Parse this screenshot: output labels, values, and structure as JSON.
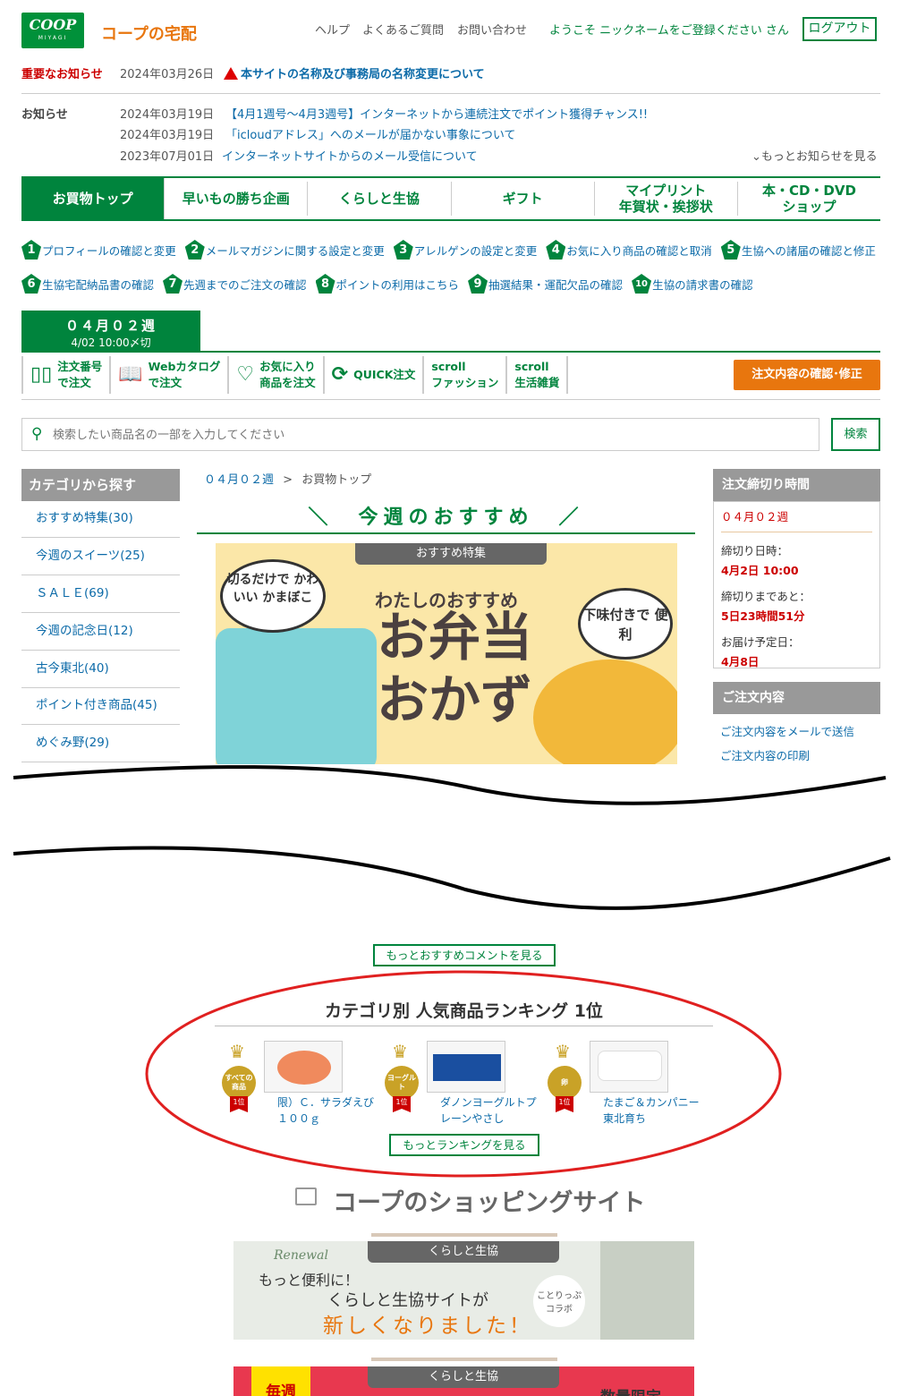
{
  "header": {
    "logo_text": "COOP",
    "logo_sub": "MIYAGI",
    "site_title": "コープの宅配",
    "links": [
      "ヘルプ",
      "よくあるご質問",
      "お問い合わせ"
    ],
    "welcome": "ようこそ ニックネームをご登録ください さん",
    "logout": "ログアウト"
  },
  "important_notice": {
    "label": "重要なお知らせ",
    "date": "2024年03月26日",
    "text": "本サイトの名称及び事務局の名称変更について"
  },
  "news": {
    "label": "お知らせ",
    "items": [
      {
        "date": "2024年03月19日",
        "text": "【4月1週号～4月3週号】インターネットから連続注文でポイント獲得チャンス!!"
      },
      {
        "date": "2024年03月19日",
        "text": "「icloudアドレス」へのメールが届かない事象について"
      },
      {
        "date": "2023年07月01日",
        "text": "インターネットサイトからのメール受信について"
      }
    ],
    "more": "もっとお知らせを見る"
  },
  "main_nav": [
    {
      "label": "お買物トップ",
      "label2": ""
    },
    {
      "label": "早いもの勝ち企画",
      "label2": ""
    },
    {
      "label": "くらしと生協",
      "label2": ""
    },
    {
      "label": "ギフト",
      "label2": ""
    },
    {
      "label": "マイプリント",
      "label2": "年賀状・挨拶状"
    },
    {
      "label": "本・CD・DVD",
      "label2": "ショップ"
    }
  ],
  "steps": [
    {
      "num": "1",
      "label": "プロフィールの確認と変更"
    },
    {
      "num": "2",
      "label": "メールマガジンに関する設定と変更"
    },
    {
      "num": "3",
      "label": "アレルゲンの設定と変更"
    },
    {
      "num": "4",
      "label": "お気に入り商品の確認と取消"
    },
    {
      "num": "5",
      "label": "生協への諸届の確認と修正"
    },
    {
      "num": "6",
      "label": "生協宅配納品書の確認"
    },
    {
      "num": "7",
      "label": "先週までのご注文の確認"
    },
    {
      "num": "8",
      "label": "ポイントの利用はこちら"
    },
    {
      "num": "9",
      "label": "抽選結果・運配欠品の確認"
    },
    {
      "num": "10",
      "label": "生協の請求書の確認"
    }
  ],
  "week_tab": {
    "week": "０４月０２週",
    "deadline": "4/02 10:00〆切"
  },
  "order_nav": [
    {
      "icon": "book-icon",
      "l1": "注文番号",
      "l2": "で注文"
    },
    {
      "icon": "catalog-icon",
      "l1": "Webカタログ",
      "l2": "で注文"
    },
    {
      "icon": "heart-icon",
      "l1": "お気に入り",
      "l2": "商品を注文"
    },
    {
      "icon": "refresh-icon",
      "l1": "QUICK注文",
      "l2": ""
    },
    {
      "icon": "",
      "l1": "scroll",
      "l2": "ファッション"
    },
    {
      "icon": "",
      "l1": "scroll",
      "l2": "生活雑貨"
    }
  ],
  "confirm_button": "注文内容の確認･修正",
  "search": {
    "placeholder": "検索したい商品名の一部を入力してください",
    "button": "検索"
  },
  "category": {
    "title": "カテゴリから探す",
    "items": [
      "おすすめ特集(30)",
      "今週のスイーツ(25)",
      "ＳＡＬＥ(69)",
      "今週の記念日(12)",
      "古今東北(40)",
      "ポイント付き商品(45)",
      "めぐみ野(29)"
    ]
  },
  "breadcrumb": {
    "week": "０４月０２週",
    "sep": ">",
    "current": "お買物トップ"
  },
  "recommend": {
    "title": "今週のおすすめ",
    "banner_tag": "おすすめ特集",
    "banner_sub": "わたしのおすすめ",
    "banner_big1": "お弁当",
    "banner_big2": "おかず",
    "bubble1": "切るだけで かわいい かまぼこ",
    "bubble2": "下味付きで 便利"
  },
  "deadline": {
    "title": "注文締切り時間",
    "week": "０４月０２週",
    "close_label": "締切り日時：",
    "close_value": "4月2日 10:00",
    "remain_label": "締切りまであと：",
    "remain_value": "5日23時間51分",
    "delivery_label": "お届け予定日：",
    "delivery_value": "4月8日"
  },
  "order_content": {
    "title": "ご注文内容",
    "links": [
      "ご注文内容をメールで送信",
      "ご注文内容の印刷"
    ]
  },
  "more_comments": "もっとおすすめコメントを見る",
  "ranking": {
    "title": "カテゴリ別 人気商品ランキング 1位",
    "items": [
      {
        "category": "すべての商品",
        "rank": "1位",
        "name": "限）Ｃ．サラダえび１００ｇ"
      },
      {
        "category": "ヨーグルト",
        "rank": "1位",
        "name": "ダノンヨーグルトプレーンやさし"
      },
      {
        "category": "卵",
        "rank": "1位",
        "name": "たまご＆カンパニー東北育ち"
      }
    ],
    "more": "もっとランキングを見る"
  },
  "shopping": {
    "title": "コープのショッピングサイト",
    "banner_tag": "くらしと生協",
    "banner_renewal": "Renewal",
    "banner_l1": "もっと便利に！",
    "banner_l2": "くらしと生協サイトが",
    "banner_l3": "新しくなりました！",
    "banner_collab": "ことりっぷ コラボ",
    "banner2_tag": "くらしと生協",
    "banner2_left": "毎週",
    "banner2_right": "数量限定"
  },
  "colors": {
    "green": "#00843d",
    "orange": "#e8760e",
    "red": "#cc0000",
    "link": "#0b6aa8"
  }
}
